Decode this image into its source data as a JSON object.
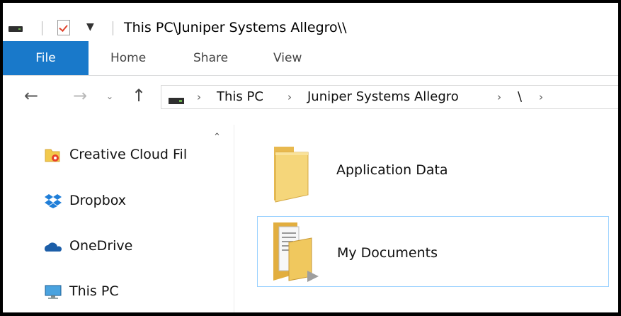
{
  "window": {
    "title": "This PC\\Juniper Systems Allegro\\\\"
  },
  "ribbon": {
    "tabs": [
      "File",
      "Home",
      "Share",
      "View"
    ]
  },
  "address_bar": {
    "crumbs": [
      "This PC",
      "Juniper Systems Allegro",
      "\\"
    ]
  },
  "nav_pane": {
    "items": [
      {
        "label": "Creative Cloud Fil",
        "icon": "creative-cloud-files-icon"
      },
      {
        "label": "Dropbox",
        "icon": "dropbox-icon"
      },
      {
        "label": "OneDrive",
        "icon": "onedrive-icon"
      },
      {
        "label": "This PC",
        "icon": "this-pc-icon"
      }
    ]
  },
  "content": {
    "items": [
      {
        "name": "Application Data",
        "icon": "folder-icon",
        "selected": false
      },
      {
        "name": "My Documents",
        "icon": "folder-documents-icon",
        "selected": true
      }
    ]
  },
  "colors": {
    "file_tab": "#1979ca",
    "selection_border": "#99d1ff",
    "folder": "#f5d67a"
  }
}
